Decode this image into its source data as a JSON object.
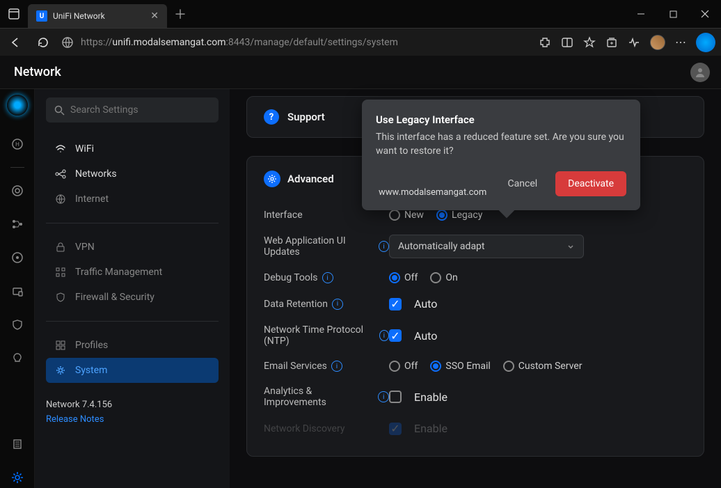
{
  "browser": {
    "tab_title": "UniFi Network",
    "url_host": "unifi.modalsemangat.com",
    "url_port_path": ":8443/manage/default/settings/system",
    "url_prefix": "https://"
  },
  "app": {
    "title": "Network"
  },
  "sidebar": {
    "search_placeholder": "Search Settings",
    "items": {
      "wifi": "WiFi",
      "networks": "Networks",
      "internet": "Internet",
      "vpn": "VPN",
      "traffic": "Traffic Management",
      "firewall": "Firewall & Security",
      "profiles": "Profiles",
      "system": "System"
    },
    "version": "Network 7.4.156",
    "release_notes": "Release Notes"
  },
  "panels": {
    "support": "Support",
    "advanced": "Advanced"
  },
  "settings": {
    "interface": {
      "label": "Interface",
      "opt_new": "New",
      "opt_legacy": "Legacy"
    },
    "web_ui": {
      "label": "Web Application UI Updates",
      "value": "Automatically adapt"
    },
    "debug": {
      "label": "Debug Tools",
      "opt_off": "Off",
      "opt_on": "On"
    },
    "retention": {
      "label": "Data Retention",
      "opt": "Auto"
    },
    "ntp": {
      "label": "Network Time Protocol (NTP)",
      "opt": "Auto"
    },
    "email": {
      "label": "Email Services",
      "opt_off": "Off",
      "opt_sso": "SSO Email",
      "opt_custom": "Custom Server"
    },
    "analytics": {
      "label": "Analytics & Improvements",
      "opt": "Enable"
    },
    "discovery": {
      "label": "Network Discovery",
      "opt": "Enable"
    }
  },
  "modal": {
    "title": "Use Legacy Interface",
    "body": "This interface has a reduced feature set. Are you sure you want to restore it?",
    "cancel": "Cancel",
    "confirm": "Deactivate",
    "url": "www.modalsemangat.com"
  }
}
